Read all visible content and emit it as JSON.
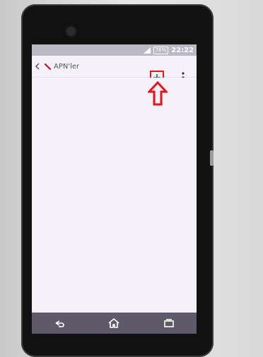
{
  "status_bar": {
    "battery": "76%",
    "time": "22:22"
  },
  "action_bar": {
    "title": "APN'ler"
  },
  "icons": {
    "back": "back-arrow-icon",
    "app": "settings-app-icon",
    "add": "plus-icon",
    "overflow": "overflow-menu-icon",
    "nav_back": "nav-back-icon",
    "nav_home": "nav-home-icon",
    "nav_recents": "nav-recents-icon"
  },
  "colors": {
    "highlight": "#e8121c",
    "nav_bar": "#5f5a69",
    "status_bar": "#bcb9c7"
  }
}
